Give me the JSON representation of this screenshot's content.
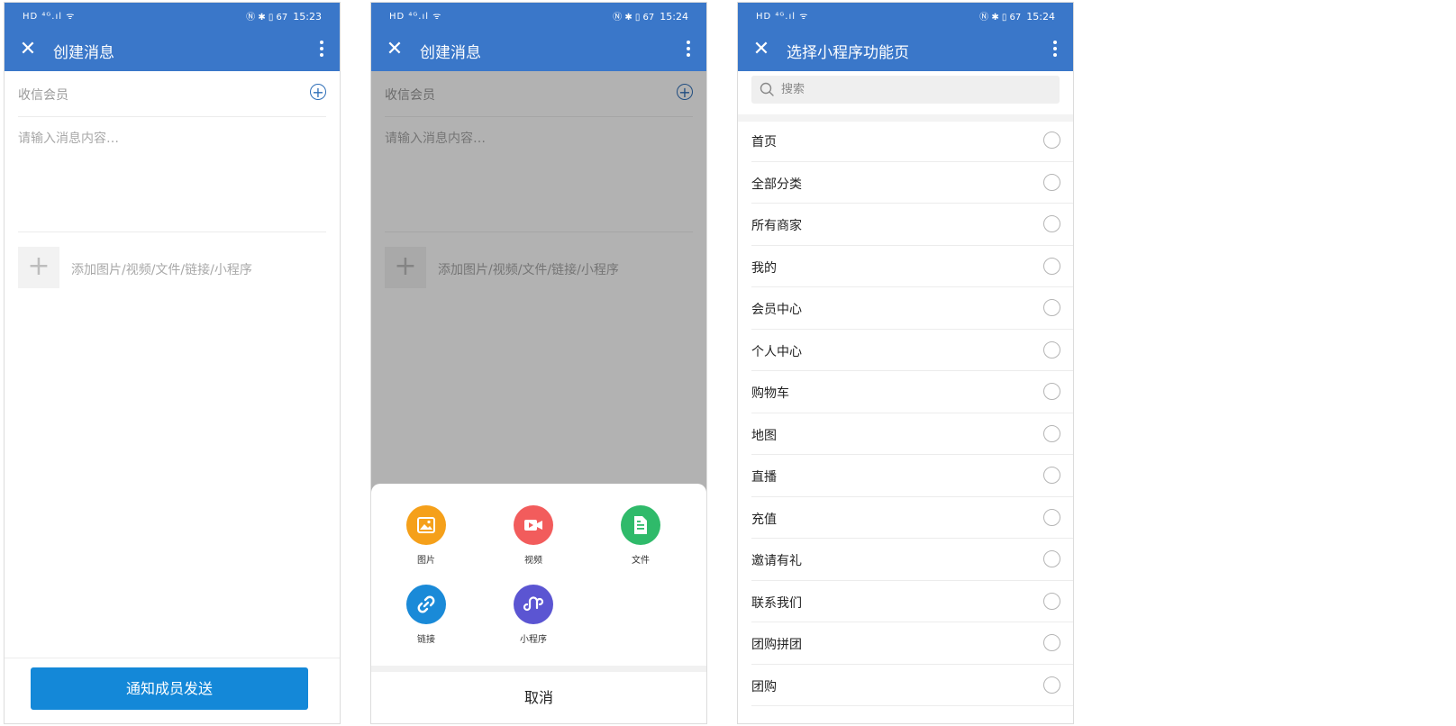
{
  "statusbar": {
    "left": "HD ⁴ᴳ.ıl ᯤ",
    "icons": "Ⓝ ✱ ▯ 67",
    "time_1": "15:23",
    "time_2": "15:24",
    "time_3": "15:24"
  },
  "compose": {
    "title": "创建消息",
    "recipient_label": "收信会员",
    "message_placeholder": "请输入消息内容…",
    "attach_hint": "添加图片/视频/文件/链接/小程序",
    "send_button": "通知成员发送"
  },
  "sheet": {
    "items": [
      {
        "label": "图片",
        "color": "#f5a01a",
        "icon": "image-icon"
      },
      {
        "label": "视频",
        "color": "#f25c5c",
        "icon": "video-icon"
      },
      {
        "label": "文件",
        "color": "#2fba6a",
        "icon": "file-icon"
      },
      {
        "label": "链接",
        "color": "#1a8ad8",
        "icon": "link-icon"
      },
      {
        "label": "小程序",
        "color": "#5b55d2",
        "icon": "mini-program-icon"
      }
    ],
    "cancel": "取消"
  },
  "picker": {
    "title": "选择小程序功能页",
    "search_placeholder": "搜索",
    "pages": [
      "首页",
      "全部分类",
      "所有商家",
      "我的",
      "会员中心",
      "个人中心",
      "购物车",
      "地图",
      "直播",
      "充值",
      "邀请有礼",
      "联系我们",
      "团购拼团",
      "团购"
    ]
  },
  "colors": {
    "header": "#3a77c9",
    "send_button": "#1488d8"
  }
}
